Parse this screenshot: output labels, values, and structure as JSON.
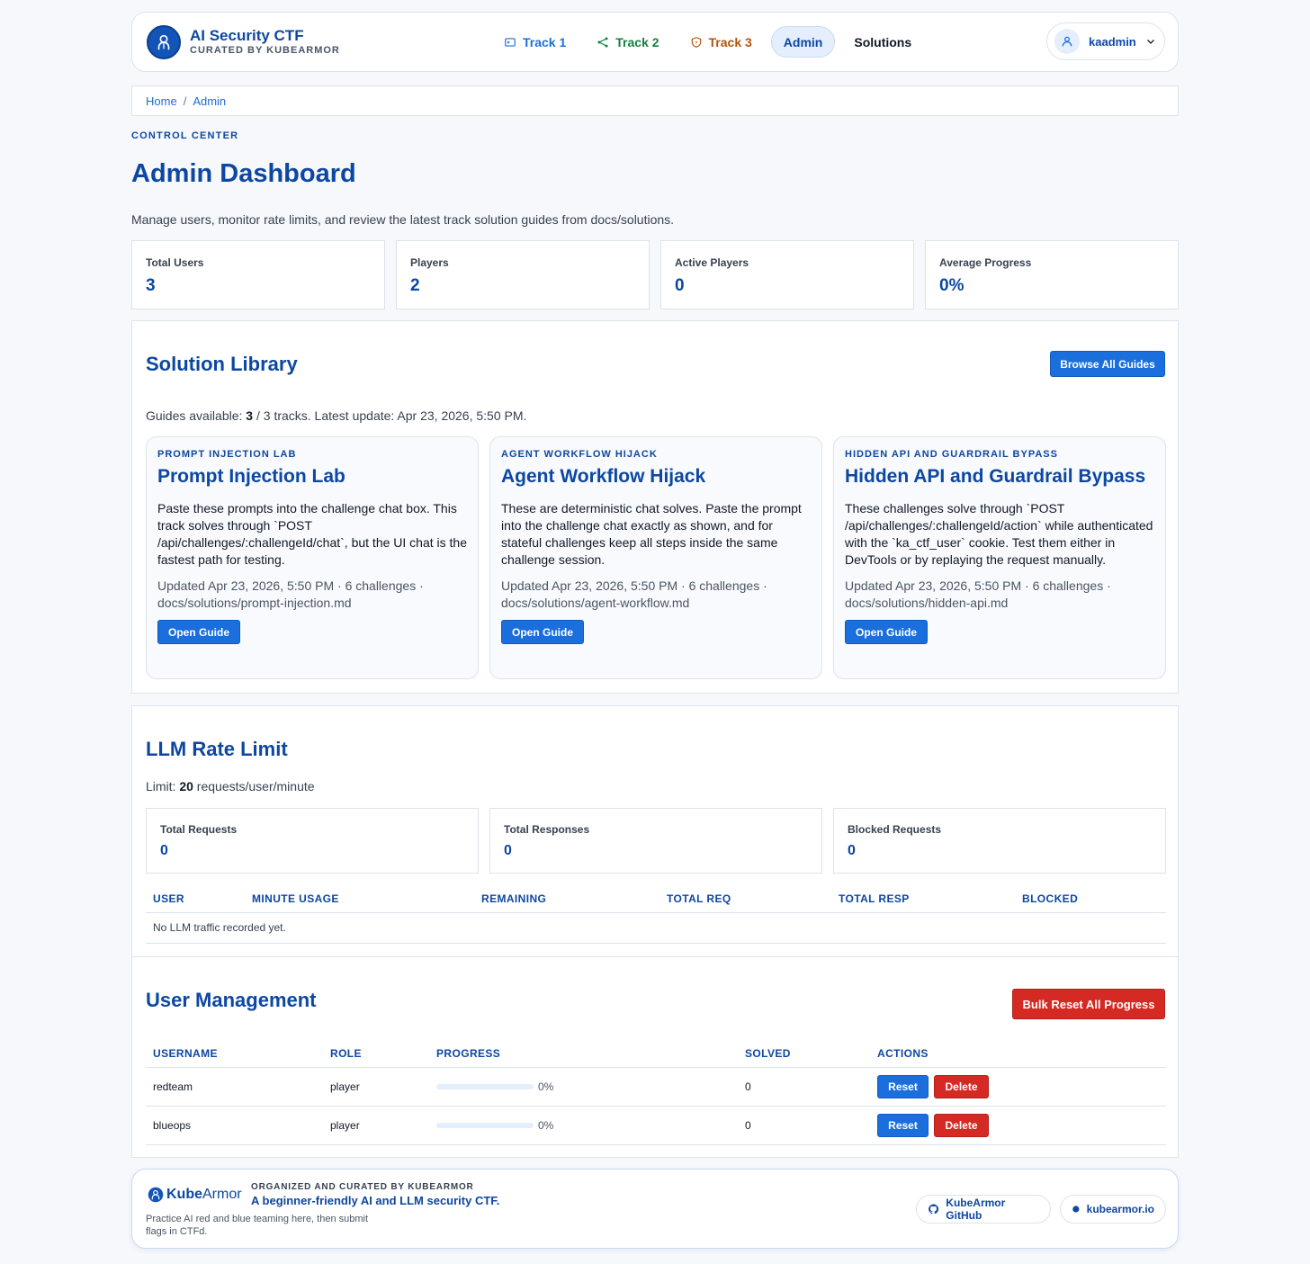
{
  "header": {
    "brand_title": "AI Security CTF",
    "brand_subtitle": "CURATED BY KUBEARMOR",
    "nav": [
      {
        "label": "Track 1",
        "icon": "terminal-icon",
        "color": "#1a6fdc"
      },
      {
        "label": "Track 2",
        "icon": "share-nodes-icon",
        "color": "#15803d"
      },
      {
        "label": "Track 3",
        "icon": "shield-icon",
        "color": "#b45309"
      },
      {
        "label": "Admin",
        "active": true
      },
      {
        "label": "Solutions"
      }
    ],
    "user": {
      "name": "kaadmin",
      "icon": "user-icon"
    }
  },
  "breadcrumb": {
    "home": "Home",
    "separator": "/",
    "current": "Admin"
  },
  "eyebrow": "CONTROL CENTER",
  "page_title": "Admin Dashboard",
  "page_description": "Manage users, monitor rate limits, and review the latest track solution guides from docs/solutions.",
  "stats": [
    {
      "label": "Total Users",
      "value": "3"
    },
    {
      "label": "Players",
      "value": "2"
    },
    {
      "label": "Active Players",
      "value": "0"
    },
    {
      "label": "Average Progress",
      "value": "0%"
    }
  ],
  "solutions": {
    "title": "Solution Library",
    "browse_label": "Browse All Guides",
    "meta_prefix": "Guides available: ",
    "meta_count": "3",
    "meta_suffix": " / 3 tracks. Latest update: Apr 23, 2026, 5:50 PM.",
    "guides": [
      {
        "tag": "PROMPT INJECTION LAB",
        "title": "Prompt Injection Lab",
        "description": "Paste these prompts into the challenge chat box. This track solves through `POST /api/challenges/:challengeId/chat`, but the UI chat is the fastest path for testing.",
        "meta": "Updated Apr 23, 2026, 5:50 PM · 6 challenges · docs/solutions/prompt-injection.md",
        "button": "Open Guide"
      },
      {
        "tag": "AGENT WORKFLOW HIJACK",
        "title": "Agent Workflow Hijack",
        "description": "These are deterministic chat solves. Paste the prompt into the challenge chat exactly as shown, and for stateful challenges keep all steps inside the same challenge session.",
        "meta": "Updated Apr 23, 2026, 5:50 PM · 6 challenges · docs/solutions/agent-workflow.md",
        "button": "Open Guide"
      },
      {
        "tag": "HIDDEN API AND GUARDRAIL BYPASS",
        "title": "Hidden API and Guardrail Bypass",
        "description": "These challenges solve through `POST /api/challenges/:challengeId/action` while authenticated with the `ka_ctf_user` cookie. Test them either in DevTools or by replaying the request manually.",
        "meta": "Updated Apr 23, 2026, 5:50 PM · 6 challenges · docs/solutions/hidden-api.md",
        "button": "Open Guide"
      }
    ]
  },
  "rate_limit": {
    "title": "LLM Rate Limit",
    "limit_prefix": "Limit: ",
    "limit_value": "20",
    "limit_suffix": " requests/user/minute",
    "stats": [
      {
        "label": "Total Requests",
        "value": "0"
      },
      {
        "label": "Total Responses",
        "value": "0"
      },
      {
        "label": "Blocked Requests",
        "value": "0"
      }
    ],
    "columns": [
      "USER",
      "MINUTE USAGE",
      "REMAINING",
      "TOTAL REQ",
      "TOTAL RESP",
      "BLOCKED"
    ],
    "empty_message": "No LLM traffic recorded yet."
  },
  "user_management": {
    "title": "User Management",
    "bulk_reset_label": "Bulk Reset All Progress",
    "columns": [
      "USERNAME",
      "ROLE",
      "PROGRESS",
      "SOLVED",
      "ACTIONS"
    ],
    "rows": [
      {
        "username": "redteam",
        "role": "player",
        "progress": 0,
        "progress_label": "0%",
        "solved": "0",
        "reset": "Reset",
        "delete": "Delete"
      },
      {
        "username": "blueops",
        "role": "player",
        "progress": 0,
        "progress_label": "0%",
        "solved": "0",
        "reset": "Reset",
        "delete": "Delete"
      }
    ]
  },
  "footer": {
    "logo_prefix": "Kube",
    "logo_suffix": "Armor",
    "tagline": "Practice AI red and blue teaming here, then submit flags in CTFd.",
    "org": "ORGANIZED AND CURATED BY KUBEARMOR",
    "headline": "A beginner-friendly AI and LLM security CTF.",
    "links": [
      {
        "label": "KubeArmor GitHub",
        "icon": "github-icon"
      },
      {
        "label": "kubearmor.io",
        "icon": "dot-icon"
      }
    ]
  },
  "colors": {
    "accent": "#1a6fdc",
    "brand": "#0d47a1",
    "danger": "#d42a23"
  }
}
